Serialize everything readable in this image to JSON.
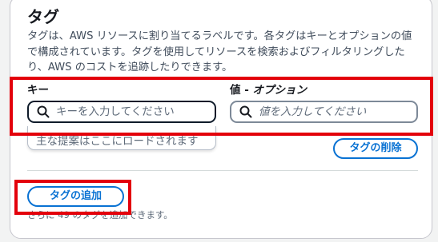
{
  "section": {
    "title": "タグ",
    "description": "タグは、AWS リソースに割り当てるラベルです。各タグはキーとオプションの値で構成されています。タグを使用してリソースを検索およびフィルタリングしたり、AWS のコストを追跡したりできます。"
  },
  "tag_row": {
    "key_label": "キー",
    "value_label_main": "値 - ",
    "value_label_optional": "オプション",
    "key_placeholder": "キーを入力してください",
    "value_placeholder": "値を入力してください",
    "key_suggestion_text": "主な提案はここにロードされます",
    "remove_button": "タグの削除"
  },
  "footer": {
    "add_button": "タグの追加",
    "hint": "さらに 49 のタグを追加できます。"
  },
  "icons": {
    "search": "search-icon"
  },
  "colors": {
    "accent": "#0972d3",
    "highlight": "#e3000b"
  }
}
